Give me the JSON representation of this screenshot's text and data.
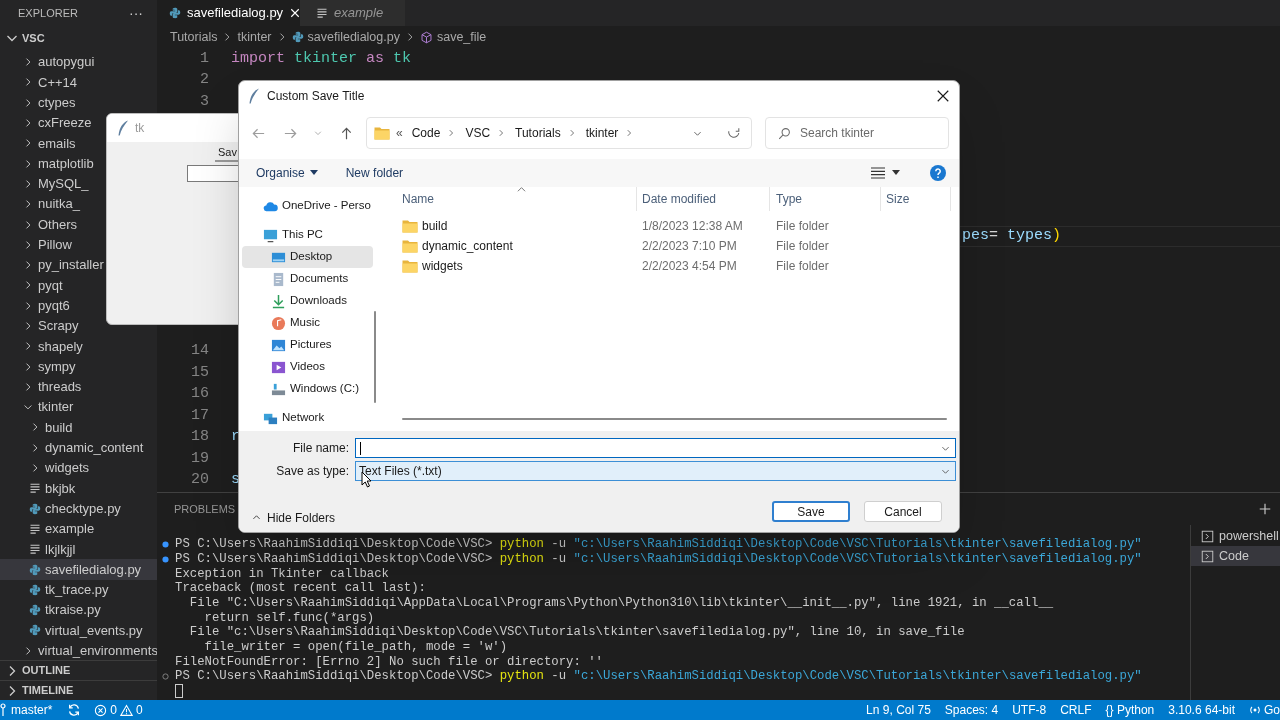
{
  "explorer": {
    "title": "EXPLORER",
    "more": "···",
    "root": {
      "label": "VSC",
      "expanded": true,
      "children": [
        {
          "label": "autopygui",
          "kind": "folder",
          "expanded": false,
          "selected": false
        },
        {
          "label": "C++14",
          "kind": "folder",
          "expanded": false,
          "selected": false
        },
        {
          "label": "ctypes",
          "kind": "folder",
          "expanded": false,
          "selected": false
        },
        {
          "label": "cxFreeze",
          "kind": "folder",
          "expanded": false,
          "selected": false
        },
        {
          "label": "emails",
          "kind": "folder",
          "expanded": false,
          "selected": false
        },
        {
          "label": "matplotlib",
          "kind": "folder",
          "expanded": false,
          "selected": false
        },
        {
          "label": "MySQL_",
          "kind": "folder",
          "expanded": false,
          "selected": false
        },
        {
          "label": "nuitka_",
          "kind": "folder",
          "expanded": false,
          "selected": false
        },
        {
          "label": "Others",
          "kind": "folder",
          "expanded": false,
          "selected": false
        },
        {
          "label": "Pillow",
          "kind": "folder",
          "expanded": false,
          "selected": false
        },
        {
          "label": "py_installer",
          "kind": "folder",
          "expanded": false,
          "selected": false
        },
        {
          "label": "pyqt",
          "kind": "folder",
          "expanded": false,
          "selected": false
        },
        {
          "label": "pyqt6",
          "kind": "folder",
          "expanded": false,
          "selected": false
        },
        {
          "label": "Scrapy",
          "kind": "folder",
          "expanded": false,
          "selected": false
        },
        {
          "label": "shapely",
          "kind": "folder",
          "expanded": false,
          "selected": false
        },
        {
          "label": "sympy",
          "kind": "folder",
          "expanded": false,
          "selected": false
        },
        {
          "label": "threads",
          "kind": "folder",
          "expanded": false,
          "selected": false
        },
        {
          "label": "tkinter",
          "kind": "folder",
          "expanded": true,
          "selected": false,
          "children": [
            {
              "label": "build",
              "kind": "folder",
              "expanded": false,
              "selected": false
            },
            {
              "label": "dynamic_content",
              "kind": "folder",
              "expanded": false,
              "selected": false
            },
            {
              "label": "widgets",
              "kind": "folder",
              "expanded": false,
              "selected": false
            },
            {
              "label": "bkjbk",
              "kind": "text",
              "selected": false
            },
            {
              "label": "checktype.py",
              "kind": "python",
              "selected": false
            },
            {
              "label": "example",
              "kind": "text",
              "selected": false
            },
            {
              "label": "lkjlkjjl",
              "kind": "text",
              "selected": false
            },
            {
              "label": "savefiledialog.py",
              "kind": "python",
              "selected": true
            },
            {
              "label": "tk_trace.py",
              "kind": "python",
              "selected": false
            },
            {
              "label": "tkraise.py",
              "kind": "python",
              "selected": false
            },
            {
              "label": "virtual_events.py",
              "kind": "python",
              "selected": false
            }
          ]
        },
        {
          "label": "virtual_environments",
          "kind": "folder",
          "expanded": false,
          "selected": false
        }
      ]
    },
    "sections": [
      {
        "label": "OUTLINE",
        "expanded": false
      },
      {
        "label": "TIMELINE",
        "expanded": false
      }
    ]
  },
  "editor": {
    "tabs": [
      {
        "label": "savefiledialog.py",
        "kind": "python",
        "selected": true,
        "preview": false
      },
      {
        "label": "example",
        "kind": "text",
        "selected": false,
        "preview": true
      }
    ],
    "breadcrumbs": [
      {
        "label": "Tutorials",
        "kind": "folder"
      },
      {
        "label": "tkinter",
        "kind": "folder"
      },
      {
        "label": "savefiledialog.py",
        "kind": "python"
      },
      {
        "label": "save_file",
        "kind": "symbol"
      }
    ],
    "lines_top": [
      {
        "number": "1",
        "tokens": [
          {
            "text": "import",
            "kind": "keyword"
          },
          {
            "text": " tkinter",
            "kind": "module"
          },
          {
            "text": " as",
            "kind": "keyword"
          },
          {
            "text": " tk",
            "kind": "module"
          }
        ]
      },
      {
        "number": "2"
      },
      {
        "number": "3"
      }
    ],
    "line_fragment": {
      "tokens": [
        {
          "text": "pes",
          "kind": "variable"
        },
        {
          "text": "=",
          "kind": "operator"
        },
        {
          "text": " types",
          "kind": "variable"
        },
        {
          "text": ")",
          "kind": "bracket"
        }
      ]
    },
    "lines_bottom": [
      {
        "number": "14"
      },
      {
        "number": "15"
      },
      {
        "number": "16"
      },
      {
        "number": "17"
      },
      {
        "number": "18",
        "tokens": [
          {
            "text": "r",
            "kind": "variable"
          }
        ]
      },
      {
        "number": "19"
      },
      {
        "number": "20",
        "tokens": [
          {
            "text": "s",
            "kind": "variable"
          }
        ]
      }
    ]
  },
  "panel": {
    "tabs": [
      {
        "label": "PROBLEMS",
        "selected": false
      }
    ],
    "terminal": [
      {
        "kind": "prompt",
        "completed": true,
        "prompt": "PS C:\\Users\\RaahimSiddiqi\\Desktop\\Code\\VSC>",
        "command": "python",
        "flag": "-u",
        "argument": "\"c:\\Users\\RaahimSiddiqi\\Desktop\\Code\\VSC\\Tutorials\\tkinter\\savefiledialog.py\""
      },
      {
        "kind": "prompt",
        "completed": true,
        "prompt": "PS C:\\Users\\RaahimSiddiqi\\Desktop\\Code\\VSC>",
        "command": "python",
        "flag": "-u",
        "argument": "\"c:\\Users\\RaahimSiddiqi\\Desktop\\Code\\VSC\\Tutorials\\tkinter\\savefiledialog.py\""
      },
      {
        "kind": "output",
        "text": "Exception in Tkinter callback"
      },
      {
        "kind": "output",
        "text": "Traceback (most recent call last):"
      },
      {
        "kind": "output",
        "text": "  File \"C:\\Users\\RaahimSiddiqi\\AppData\\Local\\Programs\\Python\\Python310\\lib\\tkinter\\__init__.py\", line 1921, in __call__"
      },
      {
        "kind": "output",
        "text": "    return self.func(*args)"
      },
      {
        "kind": "output",
        "text": "  File \"c:\\Users\\RaahimSiddiqi\\Desktop\\Code\\VSC\\Tutorials\\tkinter\\savefiledialog.py\", line 10, in save_file"
      },
      {
        "kind": "output",
        "text": "    file_writer = open(file_path, mode = 'w')"
      },
      {
        "kind": "output",
        "text": "FileNotFoundError: [Errno 2] No such file or directory: ''"
      },
      {
        "kind": "prompt",
        "completed": false,
        "prompt": "PS C:\\Users\\RaahimSiddiqi\\Desktop\\Code\\VSC>",
        "command": "python",
        "flag": "-u",
        "argument": "\"c:\\Users\\RaahimSiddiqi\\Desktop\\Code\\VSC\\Tutorials\\tkinter\\savefiledialog.py\""
      },
      {
        "kind": "cursor"
      }
    ],
    "terminals": [
      {
        "label": "powershell",
        "selected": false
      },
      {
        "label": "Code",
        "selected": true
      }
    ]
  },
  "status_bar": {
    "branch": "master*",
    "errors": "0",
    "warnings": "0",
    "items": [
      {
        "label": "Ln 9, Col 75",
        "kind": "text"
      },
      {
        "label": "Spaces: 4",
        "kind": "text"
      },
      {
        "label": "UTF-8",
        "kind": "text"
      },
      {
        "label": "CRLF",
        "kind": "text"
      },
      {
        "label": "{} Python",
        "kind": "text"
      },
      {
        "label": "3.10.6 64-bit",
        "kind": "text"
      },
      {
        "label": "Go",
        "kind": "live"
      }
    ]
  },
  "tk_window": {
    "title": "tk",
    "button": "Sav"
  },
  "save_dialog": {
    "title": "Custom Save Title",
    "overflow": "«",
    "address": [
      "Code",
      "VSC",
      "Tutorials",
      "tkinter"
    ],
    "search": {
      "placeholder": "Search tkinter"
    },
    "toolbar": [
      {
        "label": "Organise",
        "kind": "menu"
      },
      {
        "label": "New folder",
        "kind": "button"
      }
    ],
    "navigation": [
      {
        "label": "OneDrive - Perso",
        "kind": "cloud",
        "selected": false
      },
      {
        "label": "This PC",
        "kind": "pc",
        "selected": false,
        "children": [
          {
            "label": "Desktop",
            "kind": "desktop",
            "selected": true
          },
          {
            "label": "Documents",
            "kind": "documents",
            "selected": false
          },
          {
            "label": "Downloads",
            "kind": "downloads",
            "selected": false
          },
          {
            "label": "Music",
            "kind": "music",
            "selected": false
          },
          {
            "label": "Pictures",
            "kind": "pictures",
            "selected": false
          },
          {
            "label": "Videos",
            "kind": "videos",
            "selected": false
          },
          {
            "label": "Windows (C:)",
            "kind": "drive",
            "selected": false
          }
        ]
      },
      {
        "label": "Network",
        "kind": "network",
        "selected": false
      }
    ],
    "columns": [
      "Name",
      "Date modified",
      "Type",
      "Size"
    ],
    "files": [
      {
        "name": "build",
        "date": "1/8/2023 12:38 AM",
        "type": "File folder"
      },
      {
        "name": "dynamic_content",
        "date": "2/2/2023 7:10 PM",
        "type": "File folder"
      },
      {
        "name": "widgets",
        "date": "2/2/2023 4:54 PM",
        "type": "File folder"
      }
    ],
    "fields": [
      {
        "label": "File name:",
        "kind": "edit"
      },
      {
        "label": "Save as type:",
        "kind": "select",
        "value": "Text Files (*.txt)"
      }
    ],
    "hide_folders": "Hide Folders",
    "buttons": [
      {
        "label": "Save",
        "default": true
      },
      {
        "label": "Cancel",
        "default": false
      }
    ]
  }
}
